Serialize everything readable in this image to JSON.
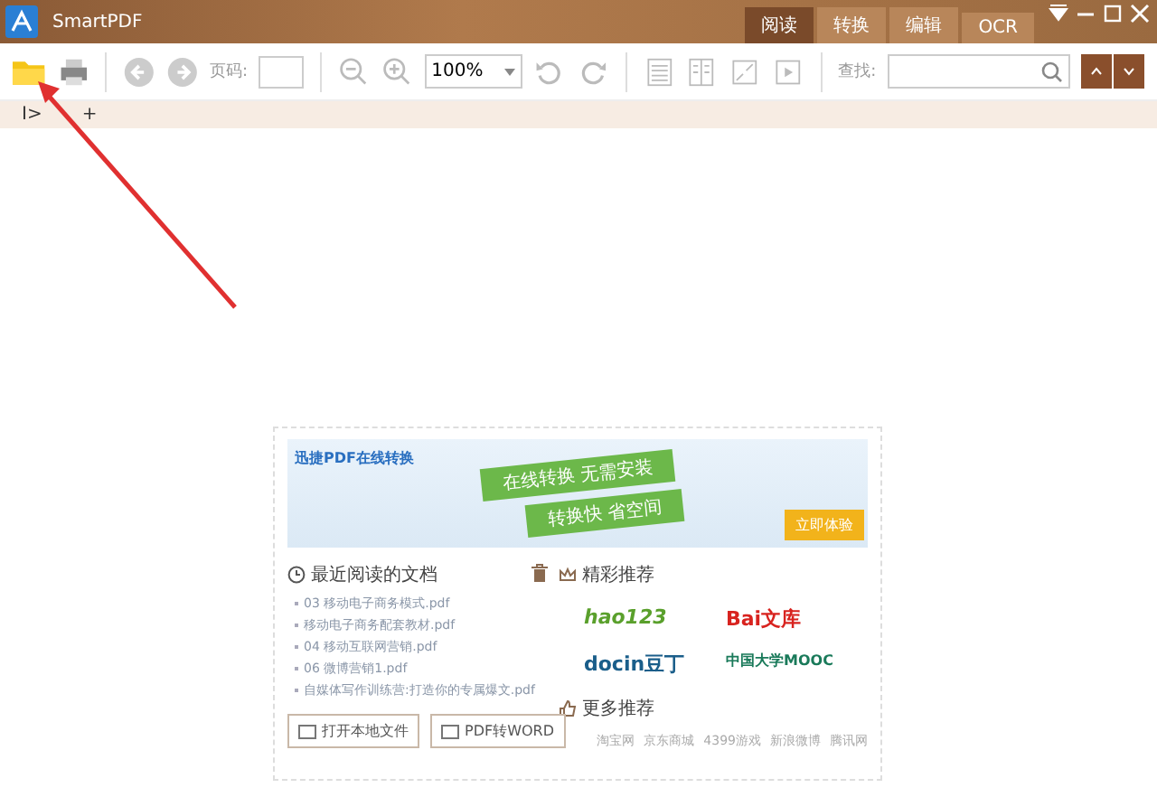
{
  "window": {
    "title": "SmartPDF"
  },
  "mode_tabs": [
    {
      "label": "阅读",
      "selected": true
    },
    {
      "label": "转换",
      "selected": false
    },
    {
      "label": "编辑",
      "selected": false
    },
    {
      "label": "OCR",
      "selected": false
    }
  ],
  "toolbar": {
    "page_label": "页码:",
    "zoom": "100%",
    "search_label": "查找:"
  },
  "doc_tabs": {
    "sidebar_toggle": "I>",
    "add": "+"
  },
  "banner": {
    "brand": "迅捷PDF在线转换",
    "ribbon_top": "在线转换 无需安装",
    "ribbon_bottom": "转换快 省空间",
    "button": "立即体验"
  },
  "recent": {
    "title": "最近阅读的文档",
    "files": [
      "03 移动电子商务模式.pdf",
      "移动电子商务配套教材.pdf",
      "04 移动互联网营销.pdf",
      "06 微博营销1.pdf",
      "自媒体写作训练营:打造你的专属爆文.pdf"
    ],
    "buttons": [
      "打开本地文件",
      "PDF转WORD"
    ]
  },
  "featured": {
    "title": "精彩推荐",
    "sites": [
      "hao123",
      "Bai文库",
      "docin豆丁",
      "中国大学MOOC"
    ]
  },
  "more": {
    "title": "更多推荐",
    "links": [
      "淘宝网",
      "京东商城",
      "4399游戏",
      "新浪微博",
      "腾讯网"
    ]
  }
}
